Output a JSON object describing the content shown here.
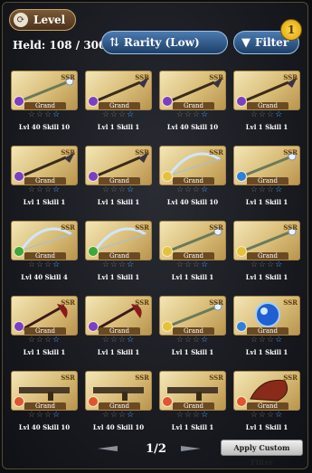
{
  "tab": {
    "label": "Level",
    "icon": "refresh-icon"
  },
  "held": {
    "label": "Held: 108 / 300"
  },
  "sort": {
    "label": "Rarity (Low)",
    "icon": "sort-arrows-icon"
  },
  "filter": {
    "label": "Filter",
    "icon": "funnel-icon",
    "badge": "1"
  },
  "card_tag": "Grand",
  "rarity": "SSR",
  "items": [
    {
      "weapon": "staff",
      "element": "dark",
      "stars": 1,
      "level": "Lvl 40 Skill 10"
    },
    {
      "weapon": "spear",
      "element": "dark",
      "stars": 1,
      "level": "Lvl 1 Skill 1"
    },
    {
      "weapon": "spear",
      "element": "dark",
      "stars": 1,
      "level": "Lvl 40 Skill 10"
    },
    {
      "weapon": "spear",
      "element": "dark",
      "stars": 0,
      "level": "Lvl 1 Skill 1"
    },
    {
      "weapon": "spear",
      "element": "dark",
      "stars": 0,
      "level": "Lvl 1 Skill 1"
    },
    {
      "weapon": "spear",
      "element": "dark",
      "stars": 0,
      "level": "Lvl 1 Skill 1"
    },
    {
      "weapon": "bow",
      "element": "light",
      "stars": 1,
      "level": "Lvl 40 Skill 10"
    },
    {
      "weapon": "staff",
      "element": "water",
      "stars": 0,
      "level": "Lvl 1 Skill 1"
    },
    {
      "weapon": "bow",
      "element": "wind",
      "stars": 0,
      "level": "Lvl 40 Skill 4"
    },
    {
      "weapon": "bow",
      "element": "wind",
      "stars": 0,
      "level": "Lvl 1 Skill 1"
    },
    {
      "weapon": "staff",
      "element": "light",
      "stars": 0,
      "level": "Lvl 1 Skill 1"
    },
    {
      "weapon": "staff",
      "element": "light",
      "stars": 0,
      "level": "Lvl 1 Skill 1"
    },
    {
      "weapon": "axe",
      "element": "dark",
      "stars": 0,
      "level": "Lvl 1 Skill 1"
    },
    {
      "weapon": "axe",
      "element": "dark",
      "stars": 0,
      "level": "Lvl 1 Skill 1"
    },
    {
      "weapon": "staff",
      "element": "light",
      "stars": 0,
      "level": "Lvl 1 Skill 1"
    },
    {
      "weapon": "orb",
      "element": "water",
      "stars": 0,
      "level": "Lvl 1 Skill 1"
    },
    {
      "weapon": "gun",
      "element": "fire",
      "stars": 1,
      "level": "Lvl 40 Skill 10"
    },
    {
      "weapon": "gun",
      "element": "fire",
      "stars": 1,
      "level": "Lvl 40 Skill 10"
    },
    {
      "weapon": "gun",
      "element": "fire",
      "stars": 0,
      "level": "Lvl 1 Skill 1"
    },
    {
      "weapon": "gauntlet",
      "element": "fire",
      "stars": 0,
      "level": "Lvl 1 Skill 1"
    }
  ],
  "element_colors": {
    "dark": "#7a3fc4",
    "light": "#e6c23a",
    "water": "#2f7fe0",
    "wind": "#3aa83a",
    "fire": "#e0552f"
  },
  "pager": {
    "label": "1/2"
  },
  "apply": {
    "label": "Apply Custom Filter"
  }
}
